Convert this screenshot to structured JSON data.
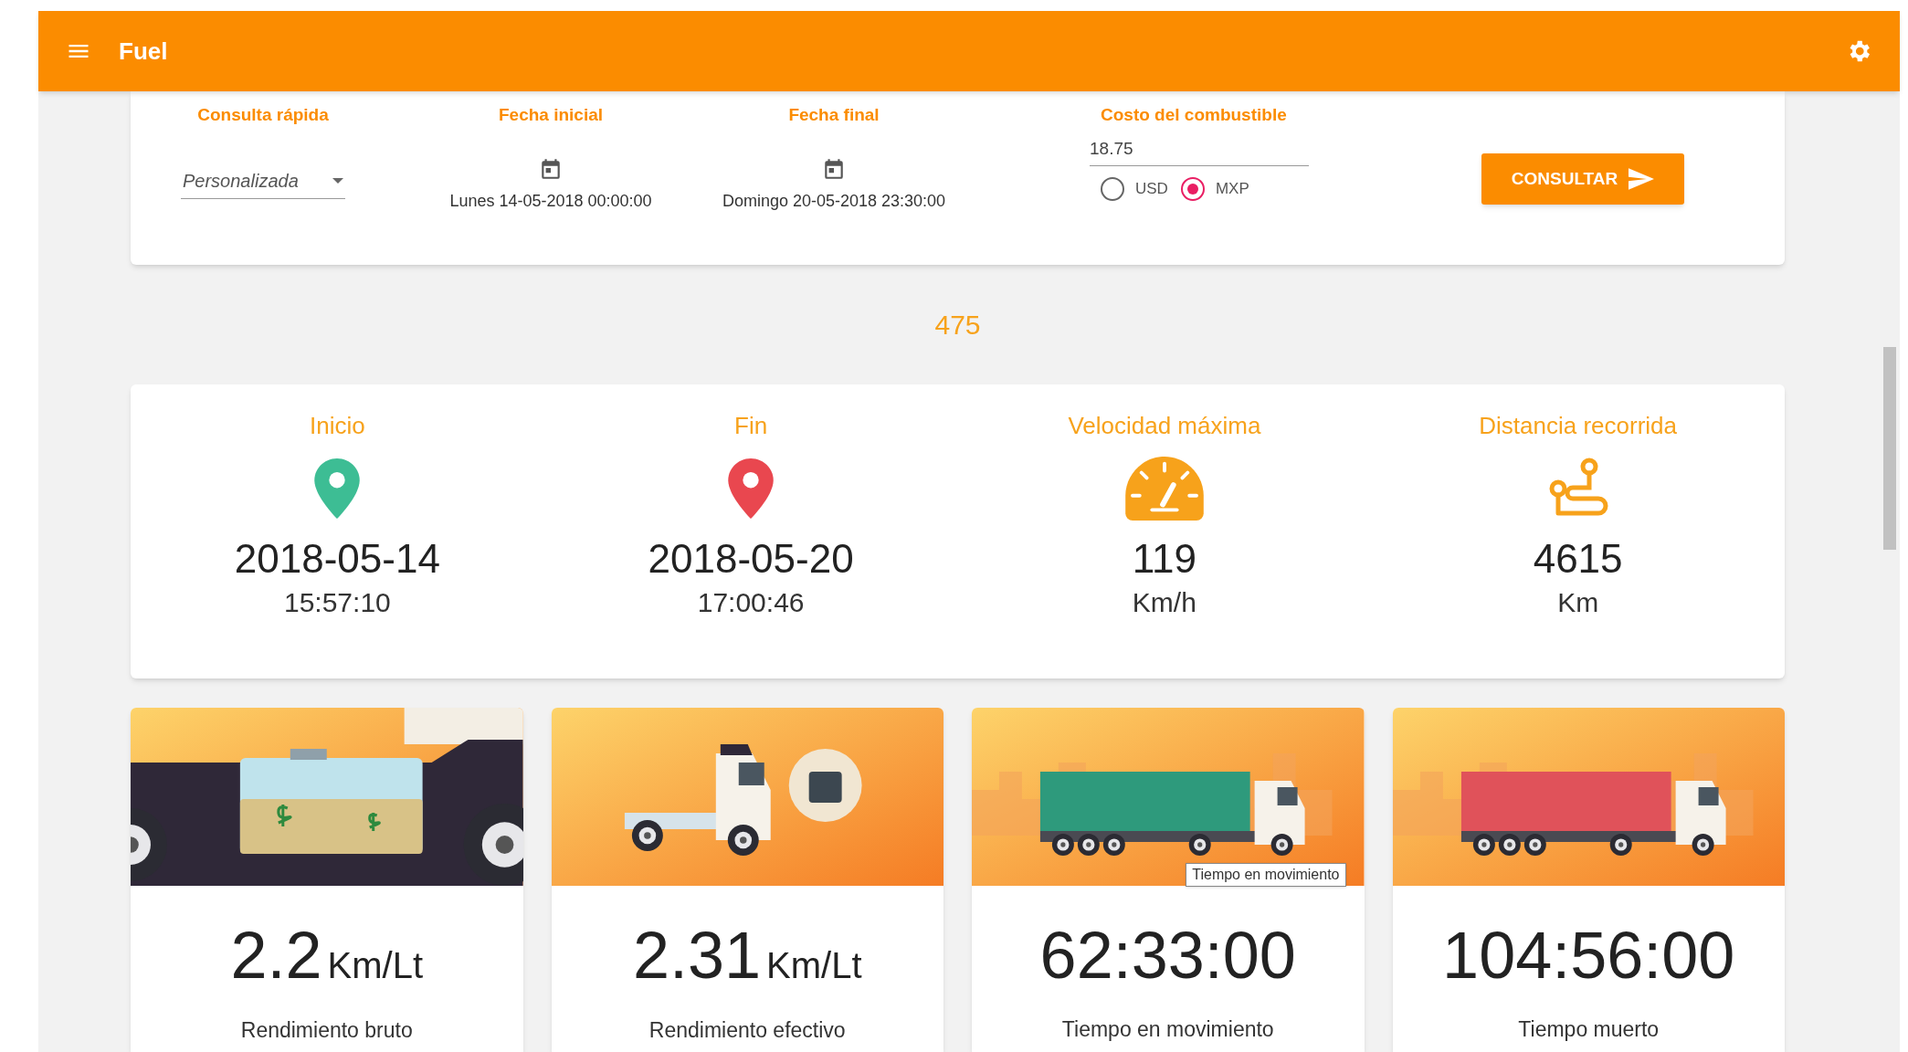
{
  "app_bar": {
    "title": "Fuel"
  },
  "filters": {
    "quick_query": {
      "label": "Consulta rápida",
      "value": "Personalizada"
    },
    "start_date": {
      "label": "Fecha inicial",
      "value": "Lunes 14-05-2018 00:00:00"
    },
    "end_date": {
      "label": "Fecha final",
      "value": "Domingo 20-05-2018 23:30:00"
    },
    "fuel_cost": {
      "label": "Costo del combustible",
      "value": "18.75",
      "currencies": [
        {
          "label": "USD",
          "selected": false
        },
        {
          "label": "MXP",
          "selected": true
        }
      ]
    },
    "submit_button": "CONSULTAR"
  },
  "record_count": "475",
  "summary": [
    {
      "kind": "pin",
      "color": "#3dbd94",
      "label": "Inicio",
      "value": "2018-05-14",
      "sub": "15:57:10"
    },
    {
      "kind": "pin",
      "color": "#e9474f",
      "label": "Fin",
      "value": "2018-05-20",
      "sub": "17:00:46"
    },
    {
      "kind": "speed",
      "color": "#f7a21b",
      "label": "Velocidad máxima",
      "value": "119",
      "sub": "Km/h"
    },
    {
      "kind": "route",
      "color": "#f7a21b",
      "label": "Distancia recorrida",
      "value": "4615",
      "sub": "Km"
    }
  ],
  "metric_cards": [
    {
      "kind": "tank",
      "value": "2.2",
      "unit": "Km/Lt",
      "label": "Rendimiento bruto"
    },
    {
      "kind": "tractor",
      "value": "2.31",
      "unit": "Km/Lt",
      "label": "Rendimiento efectivo"
    },
    {
      "kind": "trailer",
      "color": "#2e9a7c",
      "value": "62:33:00",
      "label": "Tiempo en movimiento",
      "tooltip": "Tiempo en movimiento"
    },
    {
      "kind": "trailer",
      "color": "#e0525a",
      "value": "104:56:00",
      "label": "Tiempo muerto"
    }
  ]
}
